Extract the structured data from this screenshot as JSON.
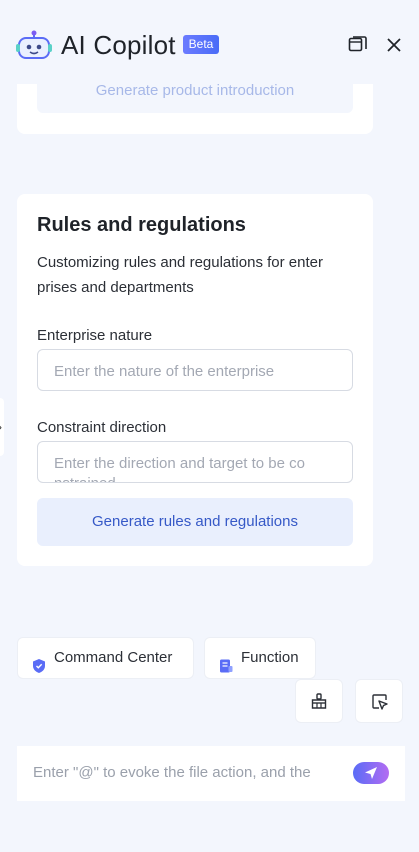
{
  "header": {
    "title": "AI Copilot",
    "badge": "Beta"
  },
  "top_card": {
    "button_label": "Generate product introduction"
  },
  "rules_card": {
    "title": "Rules and regulations",
    "description": "Customizing rules and regulations for enter prises and departments",
    "enterprise_nature": {
      "label": "Enterprise nature",
      "placeholder": "Enter the nature of the enterprise"
    },
    "constraint_direction": {
      "label": "Constraint direction",
      "placeholder": "Enter the direction and target to be co nstrained"
    },
    "generate_label": "Generate rules and regulations"
  },
  "chips": {
    "command_center": "Command Center",
    "function": "Function"
  },
  "composer": {
    "placeholder": "Enter \"@\" to evoke the file action, and the"
  },
  "colors": {
    "accent": "#4a6cf7",
    "background": "#f3f6fd",
    "button_bg": "#e9effd",
    "button_text": "#3659c7"
  }
}
